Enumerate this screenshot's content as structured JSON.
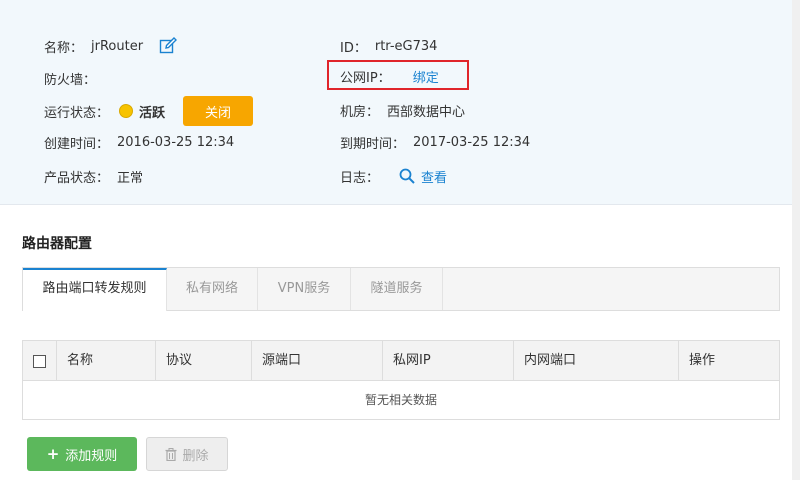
{
  "info": {
    "name_label": "名称：",
    "name_value": "jrRouter",
    "firewall_label": "防火墙：",
    "status_label": "运行状态：",
    "status_value": "活跃",
    "close_button": "关闭",
    "created_label": "创建时间：",
    "created_value": "2016-03-25 12:34",
    "product_status_label": "产品状态：",
    "product_status_value": "正常",
    "id_label": "ID：",
    "id_value": "rtr-eG734",
    "public_ip_label": "公网IP：",
    "public_ip_action": "绑定",
    "room_label": "机房：",
    "room_value": "西部数据中心",
    "expire_label": "到期时间：",
    "expire_value": "2017-03-25 12:34",
    "log_label": "日志：",
    "log_action": "查看"
  },
  "section": {
    "title": "路由器配置",
    "tabs": [
      {
        "label": "路由端口转发规则",
        "active": true
      },
      {
        "label": "私有网络",
        "active": false
      },
      {
        "label": "VPN服务",
        "active": false
      },
      {
        "label": "隧道服务",
        "active": false
      }
    ]
  },
  "table": {
    "columns": [
      "名称",
      "协议",
      "源端口",
      "私网IP",
      "内网端口",
      "操作"
    ],
    "empty_text": "暂无相关数据"
  },
  "actions": {
    "add_label": "添加规则",
    "delete_label": "删除"
  },
  "colors": {
    "accent": "#1a82d0",
    "warning": "#f7a600",
    "success": "#5cb85c",
    "highlight": "#e0252b",
    "status_dot": "#f7c300"
  },
  "icons": {
    "edit": "edit-icon",
    "search": "search-icon",
    "trash": "trash-icon",
    "plus": "plus-icon"
  }
}
